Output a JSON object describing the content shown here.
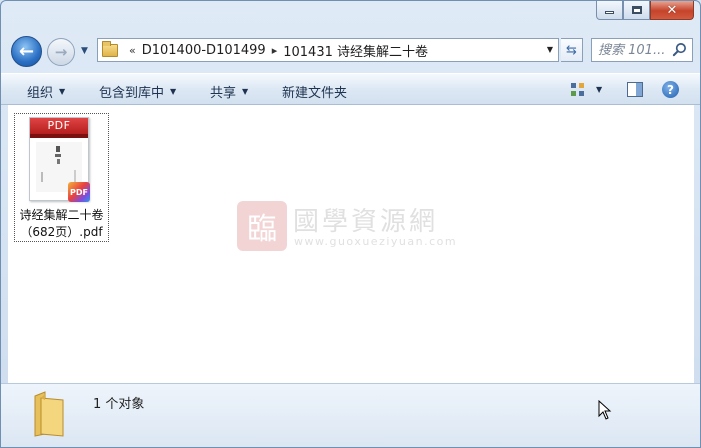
{
  "window": {
    "controls": {
      "minimize_icon": "minimize-icon",
      "maximize_icon": "maximize-icon",
      "close_glyph": "✕"
    }
  },
  "nav": {
    "back_glyph": "←",
    "forward_glyph": "→",
    "history_glyph": "▼",
    "breadcrumb_prefix": "«",
    "breadcrumb": [
      {
        "label": "D101400-D101499"
      },
      {
        "label": "101431 诗经集解二十卷"
      }
    ],
    "breadcrumb_separator": "▸",
    "address_dropdown": "▼",
    "refresh_glyph": "⇆",
    "search_placeholder": "搜索 101..."
  },
  "toolbar": {
    "organize": "组织",
    "include_in_library": "包含到库中",
    "share": "共享",
    "new_folder": "新建文件夹",
    "dropdown_glyph": "▼",
    "help_glyph": "?"
  },
  "files": [
    {
      "thumb_header": "PDF",
      "badge": "PDF",
      "name_line1": "诗经集解二十卷",
      "name_line2": "（682页）.pdf"
    }
  ],
  "watermark": {
    "seal": "臨",
    "title": "國學資源網",
    "url": "www.guoxueziyuan.com"
  },
  "status": {
    "count_text": "1 个对象"
  },
  "colors": {
    "accent": "#2a6fc4",
    "pdf_red": "#c0282a",
    "toolbar_text": "#1e3350"
  }
}
